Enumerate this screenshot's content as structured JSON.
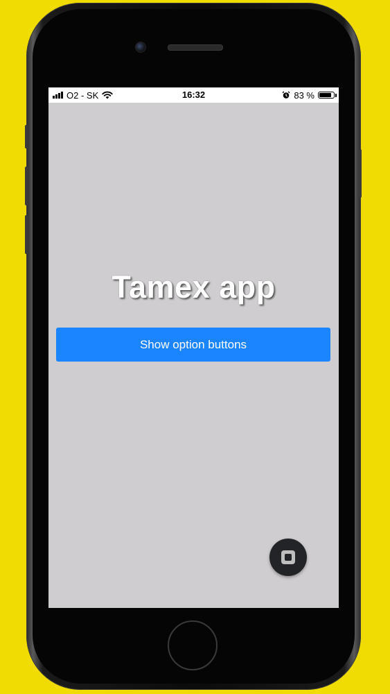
{
  "status_bar": {
    "carrier": "O2 - SK",
    "time": "16:32",
    "battery_percent": "83 %",
    "battery_level": 0.83
  },
  "app": {
    "title": "Tamex app",
    "primary_button_label": "Show option buttons",
    "accent_color": "#1a85ff",
    "screen_background": "#cfcdcf"
  },
  "icons": {
    "signal": "cellular-signal-icon",
    "wifi": "wifi-icon",
    "alarm": "alarm-clock-icon",
    "battery": "battery-icon",
    "fab": "stop-square-icon"
  },
  "device": {
    "frame_color": "#0b0b0b",
    "background_color": "#f0dc00"
  }
}
